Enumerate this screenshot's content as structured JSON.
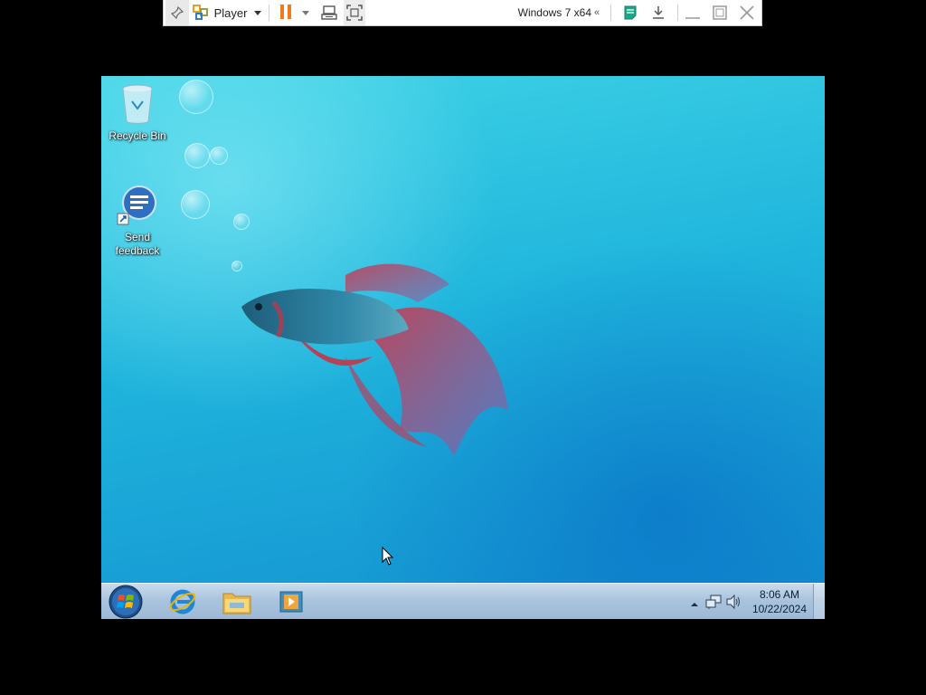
{
  "vm_toolbar": {
    "player_label": "Player",
    "vm_name": "Windows 7 x64",
    "collapse_glyph": "«",
    "icons": [
      "pin-icon",
      "player-logo-icon",
      "pause-icon",
      "send-ctrl-alt-del-icon",
      "fullscreen-icon",
      "notes-icon",
      "download-icon",
      "minimize-icon",
      "restore-icon",
      "close-icon"
    ],
    "accent_color": "#f07a1f"
  },
  "desktop": {
    "icons": [
      {
        "label": "Recycle Bin",
        "icon": "recycle-bin-icon"
      },
      {
        "label_line1": "Send",
        "label_line2": "feedback",
        "icon": "send-feedback-icon"
      }
    ]
  },
  "taskbar": {
    "pinned": [
      "internet-explorer-icon",
      "windows-explorer-icon",
      "media-player-icon"
    ],
    "clock": {
      "time": "8:06 AM",
      "date": "10/22/2024"
    },
    "tray_icons": [
      "show-hidden-icons-arrow",
      "network-icon",
      "volume-icon"
    ]
  }
}
